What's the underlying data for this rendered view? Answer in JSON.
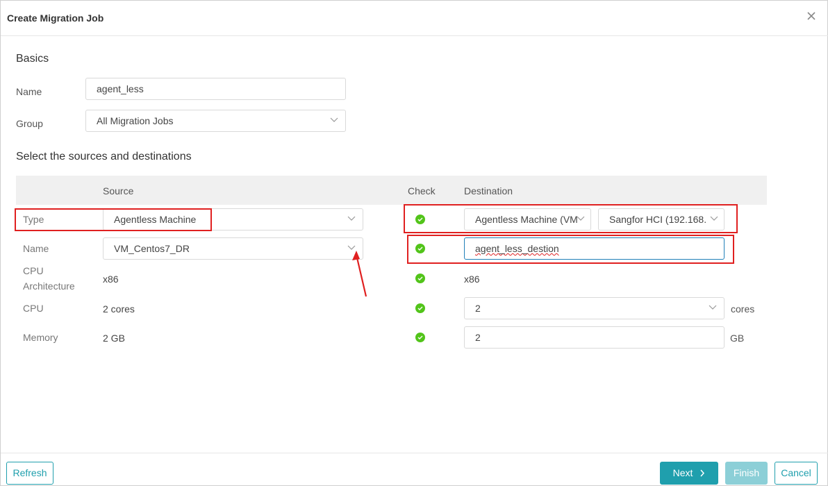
{
  "dialog": {
    "title": "Create Migration Job"
  },
  "basics": {
    "title": "Basics",
    "name_label": "Name",
    "name_value": "agent_less",
    "group_label": "Group",
    "group_value": "All Migration Jobs"
  },
  "sources": {
    "title": "Select the sources and destinations",
    "headers": {
      "source": "Source",
      "check": "Check",
      "destination": "Destination"
    },
    "rows": {
      "type": {
        "label": "Type",
        "source": "Agentless Machine",
        "dest_type": "Agentless Machine (VM",
        "dest_target": "Sangfor HCI  (192.168."
      },
      "name": {
        "label": "Name",
        "source": "VM_Centos7_DR",
        "dest": "agent_less_destion"
      },
      "cpu_arch": {
        "label_line1": "CPU",
        "label_line2": "Architecture",
        "source": "x86",
        "dest": "x86"
      },
      "cpu": {
        "label": "CPU",
        "source": "2 cores",
        "dest": "2",
        "unit": "cores"
      },
      "memory": {
        "label": "Memory",
        "source": "2 GB",
        "dest": "2",
        "unit": "GB"
      }
    }
  },
  "footer": {
    "refresh": "Refresh",
    "next": "Next",
    "finish": "Finish",
    "cancel": "Cancel"
  },
  "colors": {
    "accent": "#1f9fad",
    "success": "#52c41a",
    "highlight": "#e02020"
  },
  "icons": [
    "close-icon",
    "chevron-down-icon",
    "check-circle-icon",
    "chevron-right-icon",
    "red-arrow-annotation"
  ]
}
